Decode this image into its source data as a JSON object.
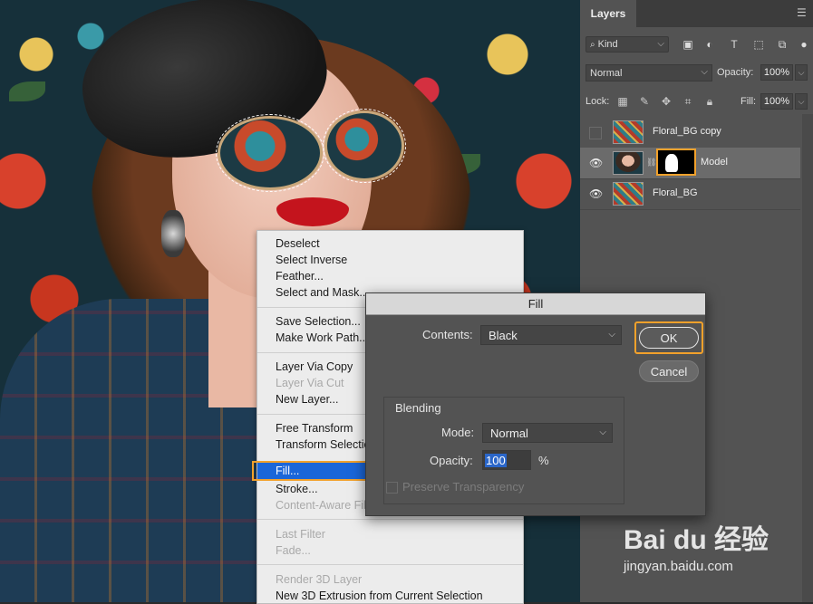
{
  "layers_panel": {
    "tab": "Layers",
    "filter_kind": "Kind",
    "blend_mode": "Normal",
    "opacity_label": "Opacity:",
    "opacity_value": "100%",
    "lock_label": "Lock:",
    "fill_label": "Fill:",
    "fill_value": "100%",
    "layers": [
      {
        "name": "Floral_BG copy",
        "visible": false,
        "selected": false
      },
      {
        "name": "Model",
        "visible": true,
        "selected": true,
        "has_mask": true
      },
      {
        "name": "Floral_BG",
        "visible": true,
        "selected": false
      }
    ]
  },
  "context_menu": {
    "items": [
      {
        "label": "Deselect",
        "disabled": false
      },
      {
        "label": "Select Inverse",
        "disabled": false
      },
      {
        "label": "Feather...",
        "disabled": false
      },
      {
        "label": "Select and Mask...",
        "disabled": false
      },
      {
        "label": "Save Selection...",
        "disabled": false
      },
      {
        "label": "Make Work Path...",
        "disabled": false
      },
      {
        "label": "Layer Via Copy",
        "disabled": false
      },
      {
        "label": "Layer Via Cut",
        "disabled": true
      },
      {
        "label": "New Layer...",
        "disabled": false
      },
      {
        "label": "Free Transform",
        "disabled": false
      },
      {
        "label": "Transform Selection",
        "disabled": false
      },
      {
        "label": "Fill...",
        "disabled": false,
        "highlighted": true
      },
      {
        "label": "Stroke...",
        "disabled": false
      },
      {
        "label": "Content-Aware Fill...",
        "disabled": true
      },
      {
        "label": "Last Filter",
        "disabled": true
      },
      {
        "label": "Fade...",
        "disabled": true
      },
      {
        "label": "Render 3D Layer",
        "disabled": true
      },
      {
        "label": "New 3D Extrusion from Current Selection",
        "disabled": false
      }
    ]
  },
  "fill_dialog": {
    "title": "Fill",
    "contents_label": "Contents:",
    "contents_value": "Black",
    "ok_label": "OK",
    "cancel_label": "Cancel",
    "blending_label": "Blending",
    "mode_label": "Mode:",
    "mode_value": "Normal",
    "opacity_label": "Opacity:",
    "opacity_value": "100",
    "opacity_unit": "%",
    "preserve_label": "Preserve Transparency"
  },
  "watermark": {
    "logo": "Bai du 经验",
    "url": "jingyan.baidu.com"
  },
  "colors": {
    "highlight_frame": "#f2a12b",
    "menu_selection": "#1a66d9",
    "panel_bg": "#535353"
  }
}
